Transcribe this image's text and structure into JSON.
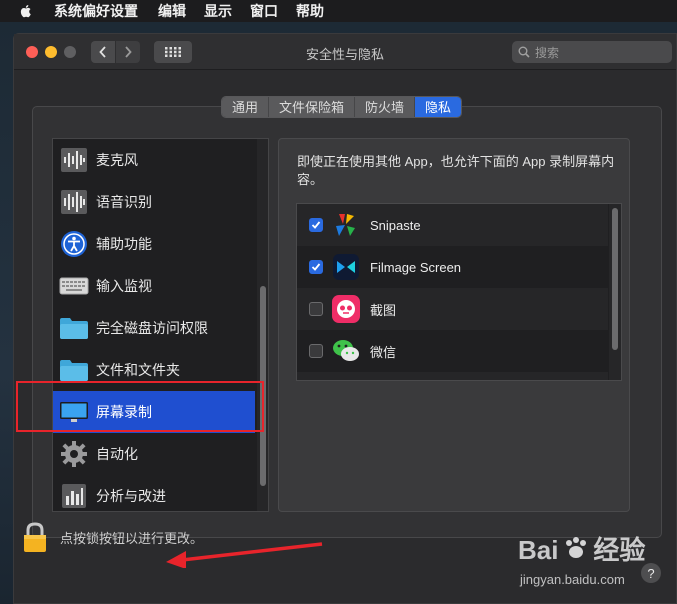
{
  "menubar": {
    "app_name": "系统偏好设置",
    "items": [
      "编辑",
      "显示",
      "窗口",
      "帮助"
    ]
  },
  "window": {
    "title": "安全性与隐私",
    "search_placeholder": "搜索"
  },
  "tabs": [
    {
      "label": "通用",
      "active": false
    },
    {
      "label": "文件保险箱",
      "active": false
    },
    {
      "label": "防火墙",
      "active": false
    },
    {
      "label": "隐私",
      "active": true
    }
  ],
  "sidebar": {
    "items": [
      {
        "label": "麦克风",
        "icon": "microphone-icon"
      },
      {
        "label": "语音识别",
        "icon": "speech-recognition-icon"
      },
      {
        "label": "辅助功能",
        "icon": "accessibility-icon"
      },
      {
        "label": "输入监视",
        "icon": "keyboard-icon"
      },
      {
        "label": "完全磁盘访问权限",
        "icon": "folder-icon"
      },
      {
        "label": "文件和文件夹",
        "icon": "folder-icon"
      },
      {
        "label": "屏幕录制",
        "icon": "display-icon",
        "selected": true
      },
      {
        "label": "自动化",
        "icon": "gear-icon"
      },
      {
        "label": "分析与改进",
        "icon": "chart-icon"
      }
    ]
  },
  "detail": {
    "description": "即使正在使用其他 App，也允许下面的 App 录制屏幕内容。",
    "apps": [
      {
        "name": "Snipaste",
        "checked": true,
        "icon": "snipaste-icon"
      },
      {
        "name": "Filmage Screen",
        "checked": true,
        "icon": "filmage-icon"
      },
      {
        "name": "截图",
        "checked": false,
        "icon": "screenshot-app-icon"
      },
      {
        "name": "微信",
        "checked": false,
        "icon": "wechat-icon"
      }
    ]
  },
  "footer": {
    "lock_text": "点按锁按钮以进行更改。",
    "help_label": "?"
  },
  "watermark": {
    "brand": "Bai",
    "brand_cn": "经验",
    "url": "jingyan.baidu.com"
  },
  "colors": {
    "accent": "#2a6ae0",
    "selection": "#1f4fd0",
    "annotation_red": "#e8242b"
  }
}
